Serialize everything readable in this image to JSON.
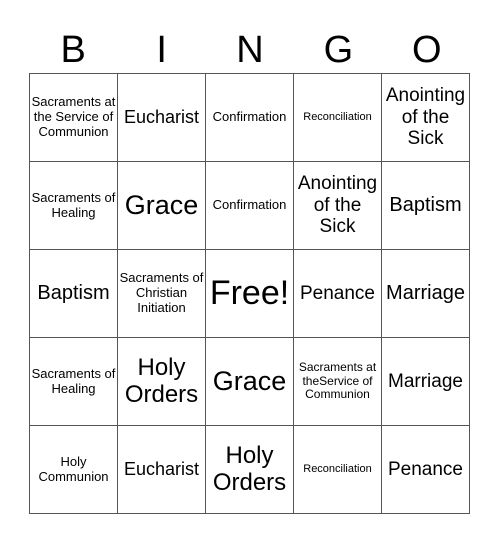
{
  "header": [
    "B",
    "I",
    "N",
    "G",
    "O"
  ],
  "cells": [
    "Sacraments at the Service of Communion",
    "Eucharist",
    "Confirmation",
    "Reconciliation",
    "Anointing of the Sick",
    "Sacraments of Healing",
    "Grace",
    "Confirmation",
    "Anointing of the Sick",
    "Baptism",
    "Baptism",
    "Sacraments of Christian Initiation",
    "Free!",
    "Penance",
    "Marriage",
    "Sacraments of Healing",
    "Holy Orders",
    "Grace",
    "Sacraments at theService of Communion",
    "Marriage",
    "Holy Communion",
    "Eucharist",
    "Holy Orders",
    "Reconciliation",
    "Penance"
  ]
}
